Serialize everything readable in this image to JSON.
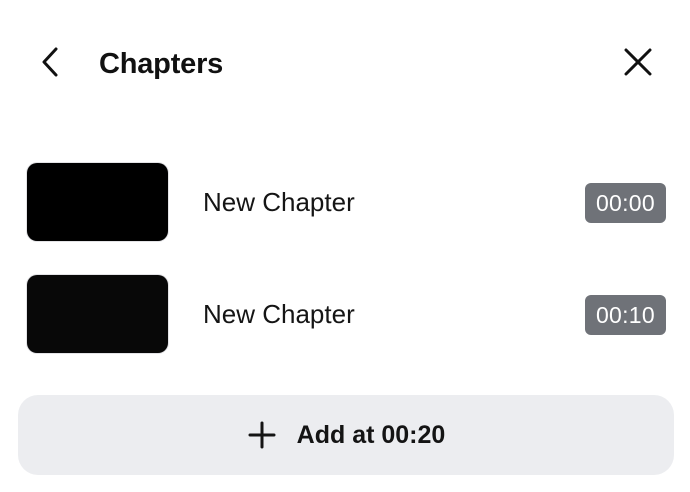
{
  "header": {
    "title": "Chapters",
    "back_icon": "chevron-left-icon",
    "close_icon": "close-icon"
  },
  "chapters": [
    {
      "label": "New Chapter",
      "time": "00:00"
    },
    {
      "label": "New Chapter",
      "time": "00:10"
    }
  ],
  "add_button": {
    "icon": "plus-icon",
    "label": "Add at 00:20"
  },
  "colors": {
    "badge_bg": "#6f7278",
    "add_button_bg": "#ecedf0",
    "thumbnail_bg": "#000000"
  }
}
